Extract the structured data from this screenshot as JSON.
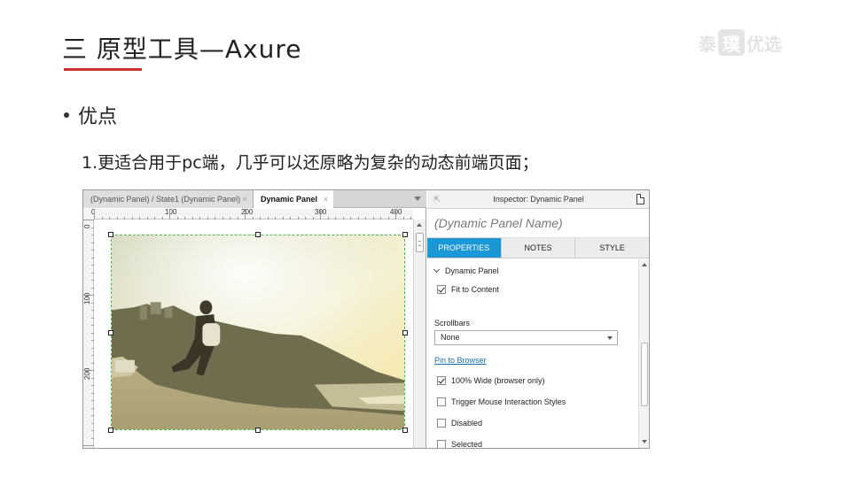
{
  "slide": {
    "title": "三 原型工具—Axure",
    "brand": {
      "left": "泰",
      "box": "璞",
      "right": "优选"
    },
    "bullet": "优点",
    "point": "1.更适合用于pc端，几乎可以还原略为复杂的动态前端页面；"
  },
  "colors": {
    "accent_red": "#c8322b",
    "tab_blue": "#1b97d6",
    "selection_green": "#3bc43b",
    "link_blue": "#1a6fb0"
  },
  "axure": {
    "tabs": [
      {
        "label": "(Dynamic Panel) / State1 (Dynamic Panel)",
        "close": "×"
      },
      {
        "label": "Dynamic Panel",
        "close": "×"
      }
    ],
    "ruler_h_labels": [
      "0",
      "100",
      "200",
      "300",
      "400"
    ],
    "ruler_v_labels": [
      "0",
      "100",
      "200"
    ],
    "inspector": {
      "title": "Inspector: Dynamic Panel",
      "name_placeholder": "(Dynamic Panel Name)",
      "tabs": [
        "PROPERTIES",
        "NOTES",
        "STYLE"
      ],
      "section": "Dynamic Panel",
      "fit_to_content": "Fit to Content",
      "scrollbars_label": "Scrollbars",
      "scrollbars_value": "None",
      "pin_link": "Pin to Browser",
      "options": [
        {
          "label": "100% Wide (browser only)",
          "checked": true
        },
        {
          "label": "Trigger Mouse Interaction Styles",
          "checked": false
        },
        {
          "label": "Disabled",
          "checked": false
        },
        {
          "label": "Selected",
          "checked": false
        }
      ]
    }
  }
}
